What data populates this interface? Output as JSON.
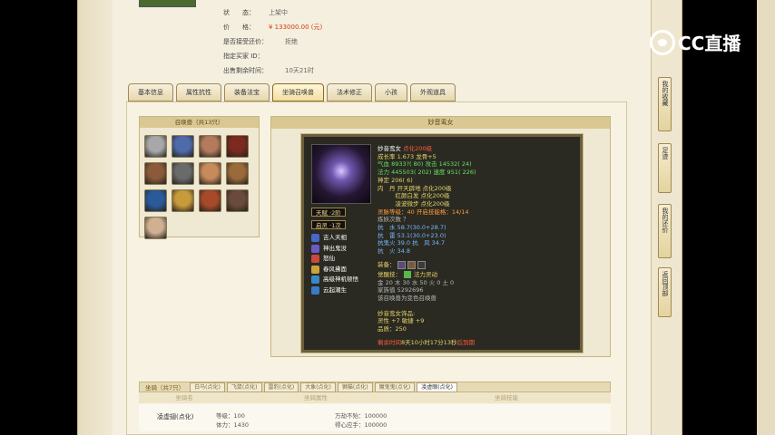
{
  "listing": {
    "status_label": "状　　态：",
    "status_value": "上架中",
    "price_label": "价　　格：",
    "price_value": "¥ 133000.00 (元)",
    "bargain_label": "是否接受还价：",
    "bargain_value": "拒绝",
    "buyer_label": "指定买家 ID：",
    "buyer_value": "",
    "time_label": "出售剩余时间：",
    "time_value": "10天21时"
  },
  "tabs": [
    "基本信息",
    "属性抗性",
    "装备法宝",
    "坐骑召唤兽",
    "法术修正",
    "小孩",
    "外观道具"
  ],
  "summons": {
    "title": "召唤兽（共13只）",
    "colors": [
      "#a8a8a8",
      "#4e6aa8",
      "#b37a5c",
      "#7a2a1e",
      "#8a5a3a",
      "#6a6a6a",
      "#c78a5a",
      "#9a6a3a",
      "#2a5a9a",
      "#c79a3a",
      "#a84a2a",
      "#6a4a3a",
      "#d0b090"
    ]
  },
  "detail": {
    "title": "妙音鸾女",
    "pill_tianfu": "天赋 ·2阶",
    "pill_qiling": "启灵 ·1次",
    "skills": [
      {
        "name": "吉人天相",
        "color": "#4a66c8"
      },
      {
        "name": "神出鬼没",
        "color": "#6a5ac8"
      },
      {
        "name": "怒仙",
        "color": "#c84a3a"
      },
      {
        "name": "春风拂面",
        "color": "#c8a43a"
      },
      {
        "name": "高级神机顿悟",
        "color": "#3a88c8"
      },
      {
        "name": "云起潮生",
        "color": "#3a7ac8"
      }
    ],
    "stats": {
      "name_line": "妙音鸾女 ",
      "name_tag": "点化200级",
      "growth": "成长率 1.673 龙骨+5",
      "hp": "气血 8933?( 80) 攻击 14532( 24)",
      "mp": "法力 445503( 202) 速度 951( 226)",
      "mag": "神定 206( 6)",
      "inner1": "内　丹 开天辟地 点化200级",
      "inner2": "　　　红颜白发 点化200级",
      "inner3": "　　　凌波微步 点化200级",
      "level": "灵脉等级：40 开启技能格：14/14",
      "train": "炼妖次数 ？",
      "res1": "抗　水 58.7(30.0+28.7)",
      "res2": "抗　雷 53.1(30.0+23.0)",
      "res3": "抗鬼火 39.0 抗　风 34.7",
      "res4": "抗　火 34.8",
      "equip_label": "装备：",
      "awaken_label": "觉醒技：",
      "awaken_value": "法力灵动",
      "attrs": "金 20 木 30 水 50 火 0 土 0",
      "extra1": "家族值 5292696",
      "extra2": "该召唤兽为变色召唤兽",
      "decor_title": "妙音鸾女饰品:",
      "decor1": "灵性 +7 敏捷 +9",
      "decor2": "品质：250",
      "expire_prefix": "剩余时间",
      "expire_value": "8天10小时17分13秒",
      "expire_suffix": "后到期"
    }
  },
  "mounts": {
    "title": "坐骑（共7只）",
    "tabs": [
      "白马(点化)",
      "飞鼠(点化)",
      "雷豹(点化)",
      "大象(点化)",
      "狮猫(点化)",
      "魔鬼鬼(点化)",
      "凌虚眼(点化)"
    ],
    "columns": [
      "坐骑名",
      "坐骑属性",
      "坐骑技能"
    ],
    "row_name": "凌虚翅(点化)",
    "row_lv_label": "等级：100",
    "row_tl_label": "体力：1430",
    "row_skill1": "万劫不殆：100000",
    "row_skill2": "得心应手：100000"
  },
  "side": {
    "fav": "我的收藏",
    "foot": "足迹",
    "bargain": "我的还价",
    "top": "返回顶部"
  },
  "brand": "CC直播"
}
